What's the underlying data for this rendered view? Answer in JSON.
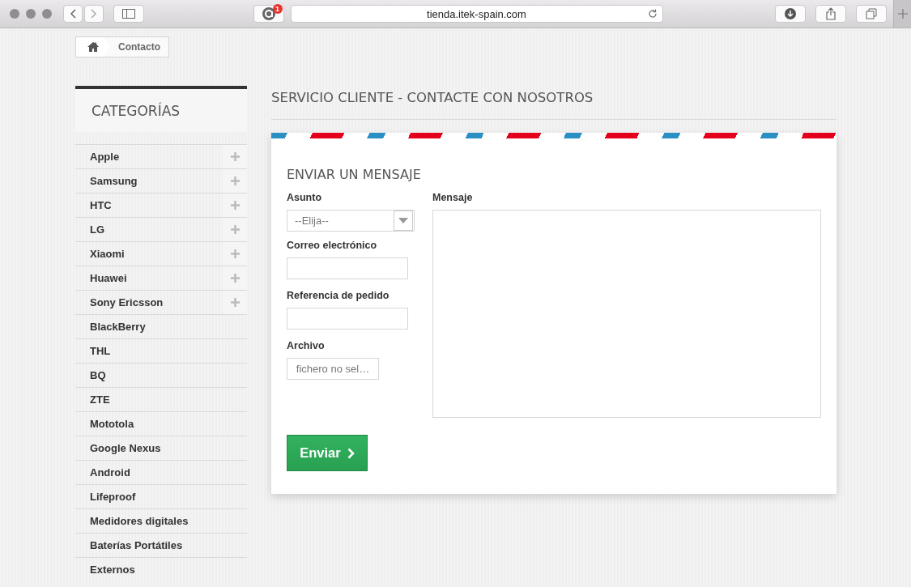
{
  "browser": {
    "url": "tienda.itek-spain.com",
    "extension_badge": "1"
  },
  "breadcrumb": {
    "current": "Contacto"
  },
  "sidebar": {
    "title": "CATEGORÍAS",
    "items": [
      {
        "label": "Apple",
        "expandable": true
      },
      {
        "label": "Samsung",
        "expandable": true
      },
      {
        "label": "HTC",
        "expandable": true
      },
      {
        "label": "LG",
        "expandable": true
      },
      {
        "label": "Xiaomi",
        "expandable": true
      },
      {
        "label": "Huawei",
        "expandable": true
      },
      {
        "label": "Sony Ericsson",
        "expandable": true
      },
      {
        "label": "BlackBerry",
        "expandable": false
      },
      {
        "label": "THL",
        "expandable": false
      },
      {
        "label": "BQ",
        "expandable": false
      },
      {
        "label": "ZTE",
        "expandable": false
      },
      {
        "label": "Mototola",
        "expandable": false
      },
      {
        "label": "Google Nexus",
        "expandable": false
      },
      {
        "label": "Android",
        "expandable": false
      },
      {
        "label": "Lifeproof",
        "expandable": false
      },
      {
        "label": "Medidores digitales",
        "expandable": false
      },
      {
        "label": "Baterías Portátiles",
        "expandable": false
      },
      {
        "label": "Externos",
        "expandable": false
      }
    ]
  },
  "page_title": "SERVICIO CLIENTE - CONTACTE CON NOSOTROS",
  "form": {
    "title": "ENVIAR UN MENSAJE",
    "fields": [
      {
        "kind": "select",
        "label": "Asunto",
        "value": "--Elija--"
      },
      {
        "kind": "text",
        "label": "Correo electrónico"
      },
      {
        "kind": "text",
        "label": "Referencia de pedido"
      },
      {
        "kind": "file",
        "label": "Archivo",
        "value": "fichero no sel…"
      }
    ],
    "message": {
      "label": "Mensaje"
    },
    "submit": "Enviar"
  }
}
